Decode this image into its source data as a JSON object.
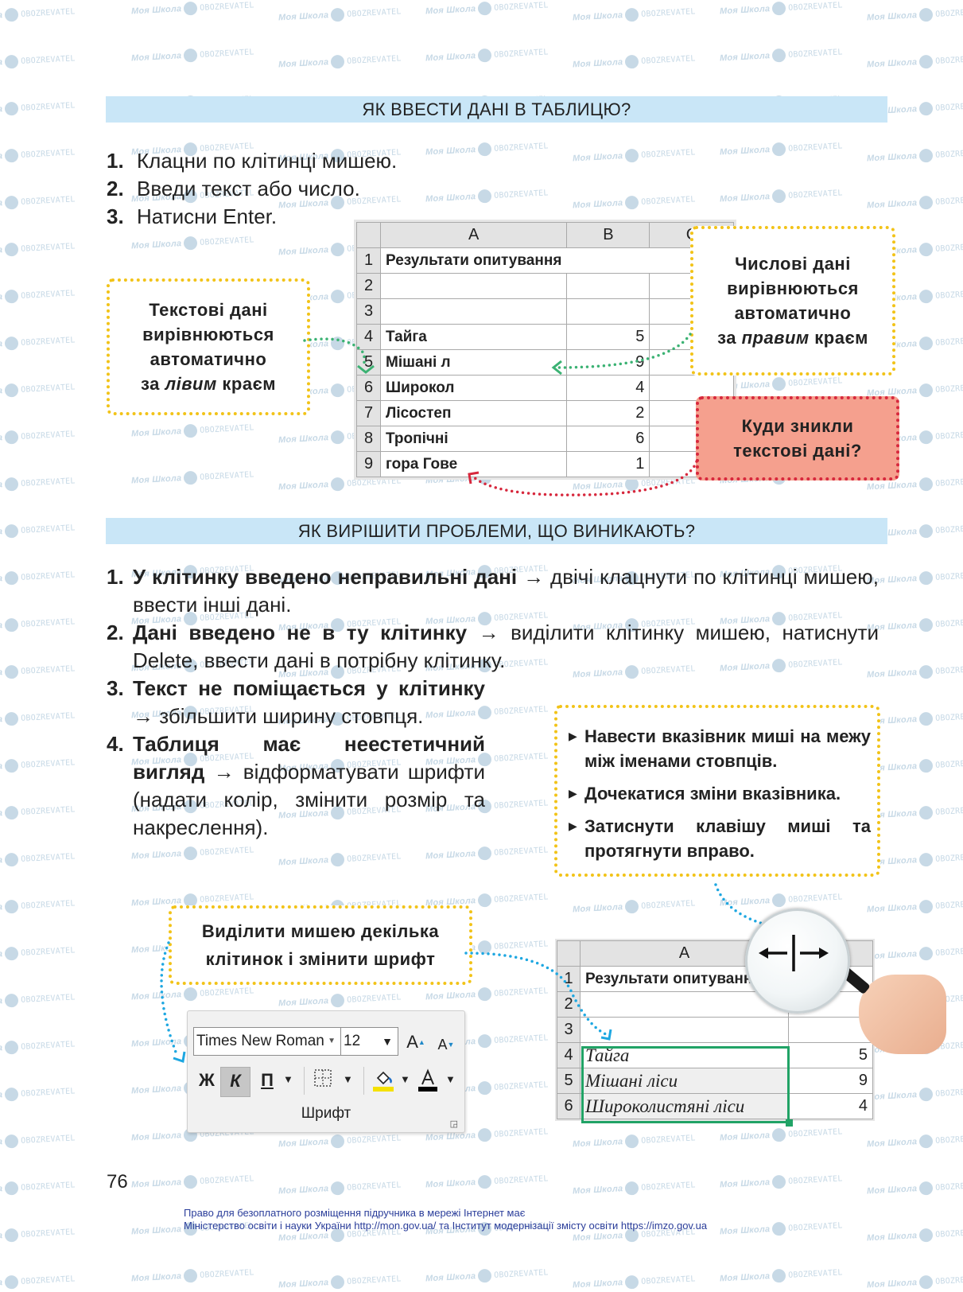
{
  "watermark": {
    "brand_left": "Моя Школа",
    "brand_right": "OBOZREVATEL"
  },
  "section1": {
    "title": "ЯК ВВЕСТИ ДАНІ В ТАБЛИЦЮ?",
    "steps": [
      {
        "num": "1.",
        "text": "Клацни по клітинці мишею."
      },
      {
        "num": "2.",
        "text": "Введи текст або число."
      },
      {
        "num": "3.",
        "text": "Натисни Enter."
      }
    ],
    "sheet": {
      "columns": [
        "A",
        "B",
        "C"
      ],
      "rows": [
        {
          "n": "1",
          "a": "Результати опитування",
          "b": "",
          "c": ""
        },
        {
          "n": "2",
          "a": "",
          "b": "",
          "c": ""
        },
        {
          "n": "3",
          "a": "",
          "b": "",
          "c": ""
        },
        {
          "n": "4",
          "a": "Тайга",
          "b": "5",
          "c": ""
        },
        {
          "n": "5",
          "a": "Мішані л",
          "b": "9",
          "c": ""
        },
        {
          "n": "6",
          "a": "Широкол",
          "b": "4",
          "c": ""
        },
        {
          "n": "7",
          "a": "Лісостеп",
          "b": "2",
          "c": ""
        },
        {
          "n": "8",
          "a": "Тропічні",
          "b": "6",
          "c": ""
        },
        {
          "n": "9",
          "a": "гора Гове",
          "b": "1",
          "c": ""
        }
      ]
    },
    "callout_text": {
      "line1": "Текстові дані",
      "line2": "вирівнюються",
      "line3": "автоматично",
      "pre": "за ",
      "em": "лівим",
      "post": " краєм"
    },
    "callout_number": {
      "line1": "Числові дані",
      "line2": "вирівнюються",
      "line3": "автоматично",
      "pre": "за ",
      "em": "правим",
      "post": " краєм"
    },
    "callout_question": {
      "line1": "Куди зникли",
      "line2": "текстові дані?"
    }
  },
  "section2": {
    "title": "ЯК ВИРІШИТИ ПРОБЛЕМИ, ЩО ВИНИКАЮТЬ?",
    "problems": [
      {
        "num": "1.",
        "bold": "У клітинку введено неправильні дані",
        "arrow": "→",
        "rest": "двічі клацнути по клітинці мишею, ввести інші дані."
      },
      {
        "num": "2.",
        "bold": "Дані введено не в ту клітинку",
        "arrow": "→",
        "rest": "виділити клітинку мишею, натиснути Delete, ввести дані в потрібну клітинку."
      },
      {
        "num": "3.",
        "bold": "Текст не поміщається у клітинку",
        "arrow": "→",
        "rest": "збільшити ширину стовпця."
      },
      {
        "num": "4.",
        "bold": "Таблиця має неестетичний вигляд",
        "arrow": "→",
        "rest": "відформатувати шрифти (надати колір, змінити розмір та накреслення)."
      }
    ],
    "instructions": [
      "Навести вказівник миші на межу між іменами стовпців.",
      "Дочекатися зміни вказівника.",
      "Затиснути клавішу миші та протягнути вправо."
    ],
    "callout_select": {
      "line1": "Виділити мишею декілька",
      "line2": "клітинок і змінити шрифт"
    },
    "ribbon": {
      "font_name": "Times New Roman",
      "font_size": "12",
      "grow_font": "A",
      "shrink_font": "A",
      "bold": "Ж",
      "italic": "К",
      "underline": "П",
      "group_label": "Шрифт",
      "fill_color": "#f5e100",
      "font_color": "#000000",
      "italic_selected": true
    },
    "sheet": {
      "columns": [
        "A",
        ""
      ],
      "rows": [
        {
          "n": "1",
          "a": "Результати опитуванн",
          "b": ""
        },
        {
          "n": "2",
          "a": "",
          "b": ""
        },
        {
          "n": "3",
          "a": "",
          "b": ""
        },
        {
          "n": "4",
          "a": "Тайга",
          "b": "5"
        },
        {
          "n": "5",
          "a": "Мішані ліси",
          "b": "9"
        },
        {
          "n": "6",
          "a": "Широколистяні ліси",
          "b": "4"
        }
      ]
    }
  },
  "page_number": "76",
  "footer": {
    "line1": "Право для безоплатного розміщення підручника в мережі Інтернет має",
    "line2": "Міністерство освіти і науки України http://mon.gov.ua/ та Інститут модернізації змісту освіти https://imzo.gov.ua"
  },
  "colors": {
    "band": "#c9e6f7",
    "callout_border": "#f2c318",
    "question_fill": "#f5a08e",
    "question_border": "#d7283d",
    "arrow_green": "#3bb273",
    "arrow_blue": "#1ea7e1",
    "selection": "#21a366",
    "footer_link": "#2a3d9a"
  }
}
